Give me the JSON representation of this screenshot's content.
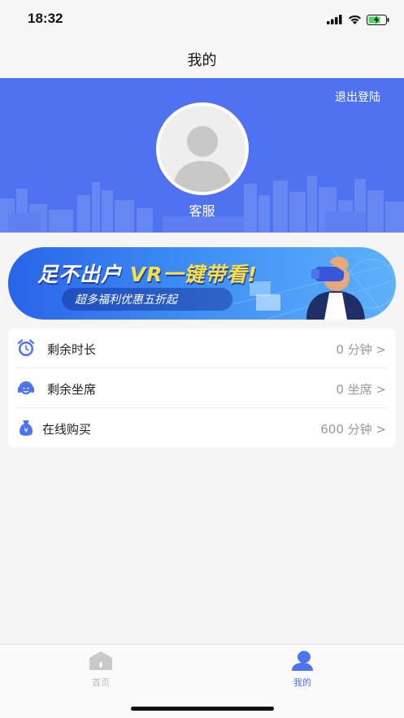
{
  "status_bar": {
    "time": "18:32"
  },
  "nav": {
    "title": "我的"
  },
  "profile": {
    "logout_label": "退出登陆",
    "username": "客服"
  },
  "banner": {
    "title_part1": "足不出户 ",
    "title_vr": "VR一键带看!",
    "subtitle": "超多福利优惠五折起"
  },
  "menu": {
    "items": [
      {
        "label": "剩余时长",
        "value": "0 分钟 >",
        "icon": "alarm-clock-icon"
      },
      {
        "label": "剩余坐席",
        "value": "0 坐席 >",
        "icon": "headset-agent-icon"
      },
      {
        "label": "在线购买",
        "value": "600 分钟 >",
        "icon": "money-bag-icon"
      }
    ]
  },
  "tabbar": {
    "tabs": [
      {
        "label": "首页",
        "icon": "home-icon",
        "active": false
      },
      {
        "label": "我的",
        "icon": "user-icon",
        "active": true
      }
    ]
  },
  "colors": {
    "accent": "#4f73f0",
    "tab_active": "#4d73f0",
    "tab_inactive": "#bbbbbb",
    "menu_icon": "#4f73f0"
  }
}
